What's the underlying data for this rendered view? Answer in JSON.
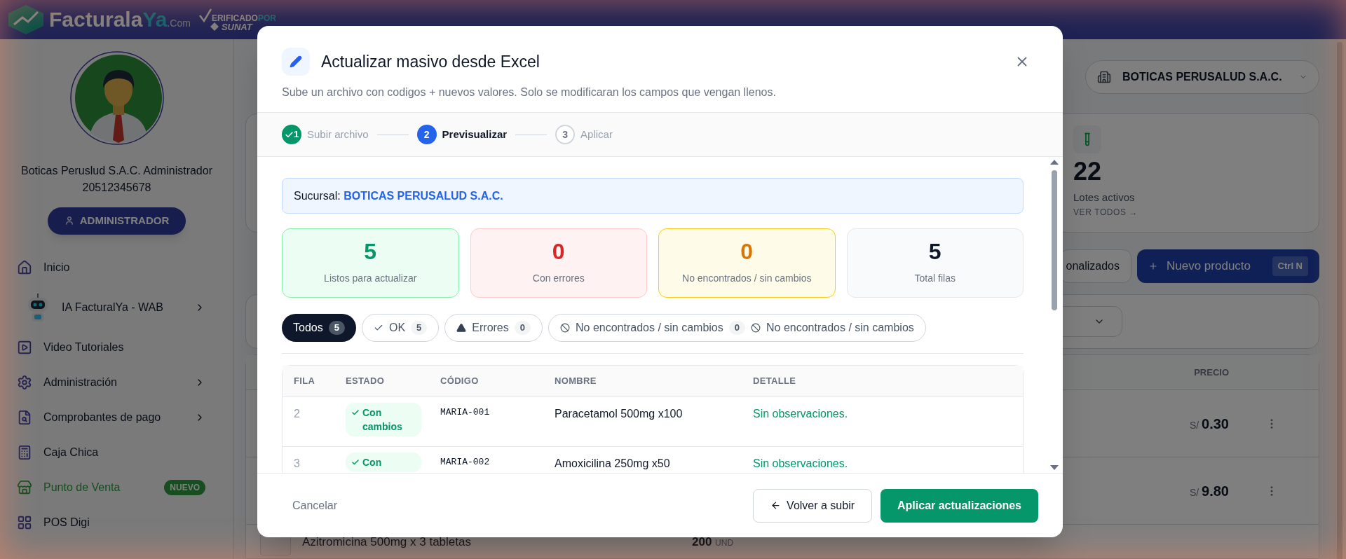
{
  "header": {
    "brand_main": "Facturala",
    "brand_accent": "Ya",
    "brand_suffix": ".Com",
    "verified_text": "ERIFICADO",
    "verified_by": "POR",
    "verified_entity": "SUNAT"
  },
  "sidebar": {
    "profile_name": "Boticas Peruslud S.A.C. Administrador",
    "profile_id": "20512345678",
    "role_button": "ADMINISTRADOR",
    "items": [
      {
        "label": "Inicio",
        "kind": "link",
        "has_submenu": false,
        "selected": false
      },
      {
        "label": "IA FacturalYa - WAB",
        "kind": "assistant",
        "has_submenu": true,
        "selected": false
      },
      {
        "label": "Video Tutoriales",
        "kind": "link",
        "has_submenu": false,
        "selected": false
      },
      {
        "label": "Administración",
        "kind": "link",
        "has_submenu": true,
        "selected": false
      },
      {
        "label": "Comprobantes de pago",
        "kind": "link",
        "has_submenu": true,
        "selected": false
      },
      {
        "label": "Caja Chica",
        "kind": "link",
        "has_submenu": false,
        "selected": false
      },
      {
        "label": "Punto de Venta",
        "kind": "link",
        "has_submenu": false,
        "selected": true,
        "badge": "NUEVO"
      },
      {
        "label": "POS Digi",
        "kind": "link",
        "has_submenu": false,
        "selected": false
      }
    ]
  },
  "main": {
    "company_selector": "BOTICAS PERUSALUD S.A.C.",
    "stat": {
      "value": "22",
      "label": "Lotes activos",
      "link": "VER TODOS →"
    },
    "toolbar": {
      "partial_button": "onalizados",
      "new_button": "Nuevo producto",
      "shortcut": "Ctrl N"
    },
    "table": {
      "price_column": "PRECIO",
      "rows": [
        {
          "currency": "S/",
          "price": "0.30"
        },
        {
          "currency": "S/",
          "price": "9.80"
        }
      ],
      "bottom_row": {
        "name": "Azitromicina 500mg x 3 tabletas",
        "stock": "200",
        "unit": "UND"
      }
    }
  },
  "modal": {
    "title": "Actualizar masivo desde Excel",
    "subtitle": "Sube un archivo con codigos + nuevos valores. Solo se modificaran los campos que vengan llenos.",
    "steps": [
      {
        "number": "1",
        "label": "Subir archivo",
        "kind": "done"
      },
      {
        "number": "2",
        "label": "Previsualizar",
        "kind": "current"
      },
      {
        "number": "3",
        "label": "Aplicar",
        "kind": "pending"
      }
    ],
    "branch": {
      "label": "Sucursal:",
      "value": "BOTICAS PERUSALUD S.A.C."
    },
    "stats": [
      {
        "value": "5",
        "label": "Listos para actualizar",
        "kind": "success"
      },
      {
        "value": "0",
        "label": "Con errores",
        "kind": "error"
      },
      {
        "value": "0",
        "label": "No encontrados / sin cambios",
        "kind": "warning"
      },
      {
        "value": "5",
        "label": "Total filas",
        "kind": "neutral"
      }
    ],
    "filters": [
      {
        "kind": "all",
        "label": "Todos",
        "count": "5",
        "selected": true
      },
      {
        "kind": "ok",
        "label": "OK",
        "count": "5",
        "selected": false
      },
      {
        "kind": "error",
        "label": "Errores",
        "count": "0",
        "selected": false
      },
      {
        "kind": "skipped",
        "label": "No encontrados / sin cambios",
        "count": "0",
        "selected": false,
        "suffix": "No encontrados / sin cambios"
      }
    ],
    "table": {
      "columns": [
        "FILA",
        "ESTADO",
        "CÓDIGO",
        "NOMBRE",
        "DETALLE"
      ],
      "rows": [
        {
          "row": "2",
          "status": "Con cambios",
          "code": "MARIA-001",
          "name": "Paracetamol 500mg x100",
          "detail": "Sin observaciones."
        },
        {
          "row": "3",
          "status": "Con",
          "code": "MARIA-002",
          "name": "Amoxicilina 250mg x50",
          "detail": "Sin observaciones."
        }
      ]
    },
    "footer": {
      "cancel": "Cancelar",
      "back": "Volver a subir",
      "apply": "Aplicar actualizaciones"
    }
  }
}
